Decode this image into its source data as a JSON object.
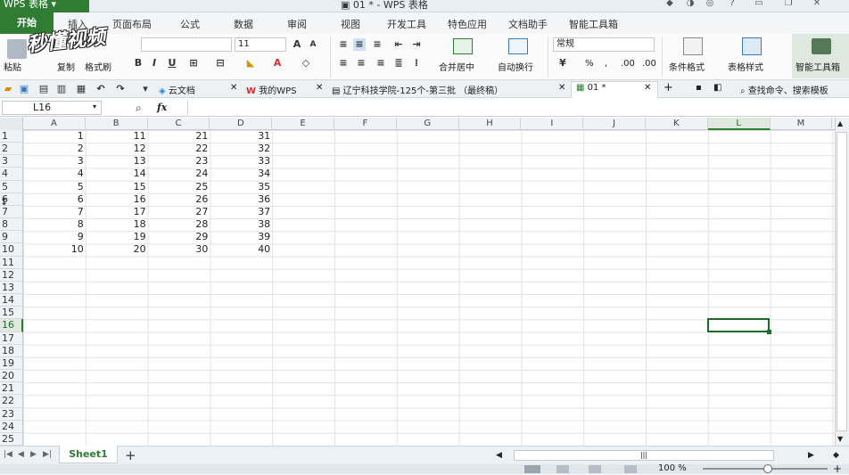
{
  "app": {
    "name": "WPS 表格",
    "doc_title": "01 * - WPS 表格"
  },
  "menu": [
    "开始",
    "插入",
    "页面布局",
    "公式",
    "数据",
    "审阅",
    "视图",
    "开发工具",
    "特色应用",
    "文档助手",
    "智能工具箱"
  ],
  "watermark": "秒懂视频",
  "ribbon": {
    "paste": "粘贴",
    "copy": "复制",
    "format_painter": "格式刷",
    "font_size": "11",
    "merge_center": "合并居中",
    "wrap_text": "自动换行",
    "number_format": "常规",
    "percent": "%",
    "comma": ",",
    "dec_inc": ".00",
    "dec_dec": ".00",
    "conditional_format": "条件格式",
    "table_style": "表格样式",
    "smart_toolbox": "智能工具箱"
  },
  "doctabs": {
    "cloud_docs": "云文档",
    "my_wps": "我的WPS",
    "doc1": "辽宁科技学院-125个-第三批 （最终稿）",
    "doc2": "01 *",
    "search": "查找命令、搜索模板"
  },
  "namebox": "L16",
  "fx": "fx",
  "columns": [
    "A",
    "B",
    "C",
    "D",
    "E",
    "F",
    "G",
    "H",
    "I",
    "J",
    "K",
    "L",
    "M"
  ],
  "rows": [
    "1",
    "2",
    "3",
    "4",
    "5",
    "6",
    "7",
    "8",
    "9",
    "10",
    "11",
    "12",
    "13",
    "14",
    "15",
    "16",
    "17",
    "18",
    "19",
    "20",
    "21",
    "22",
    "23",
    "24",
    "25"
  ],
  "cells": [
    [
      "1",
      "11",
      "21",
      "31"
    ],
    [
      "2",
      "12",
      "22",
      "32"
    ],
    [
      "3",
      "13",
      "23",
      "33"
    ],
    [
      "4",
      "14",
      "24",
      "34"
    ],
    [
      "5",
      "15",
      "25",
      "35"
    ],
    [
      "6",
      "16",
      "26",
      "36"
    ],
    [
      "7",
      "17",
      "27",
      "37"
    ],
    [
      "8",
      "18",
      "28",
      "38"
    ],
    [
      "9",
      "19",
      "29",
      "39"
    ],
    [
      "10",
      "20",
      "30",
      "40"
    ]
  ],
  "sheet_tab": "Sheet1",
  "zoom": "100 %",
  "colors": {
    "accent": "#2e7d32",
    "selection": "#1e6b2a"
  }
}
